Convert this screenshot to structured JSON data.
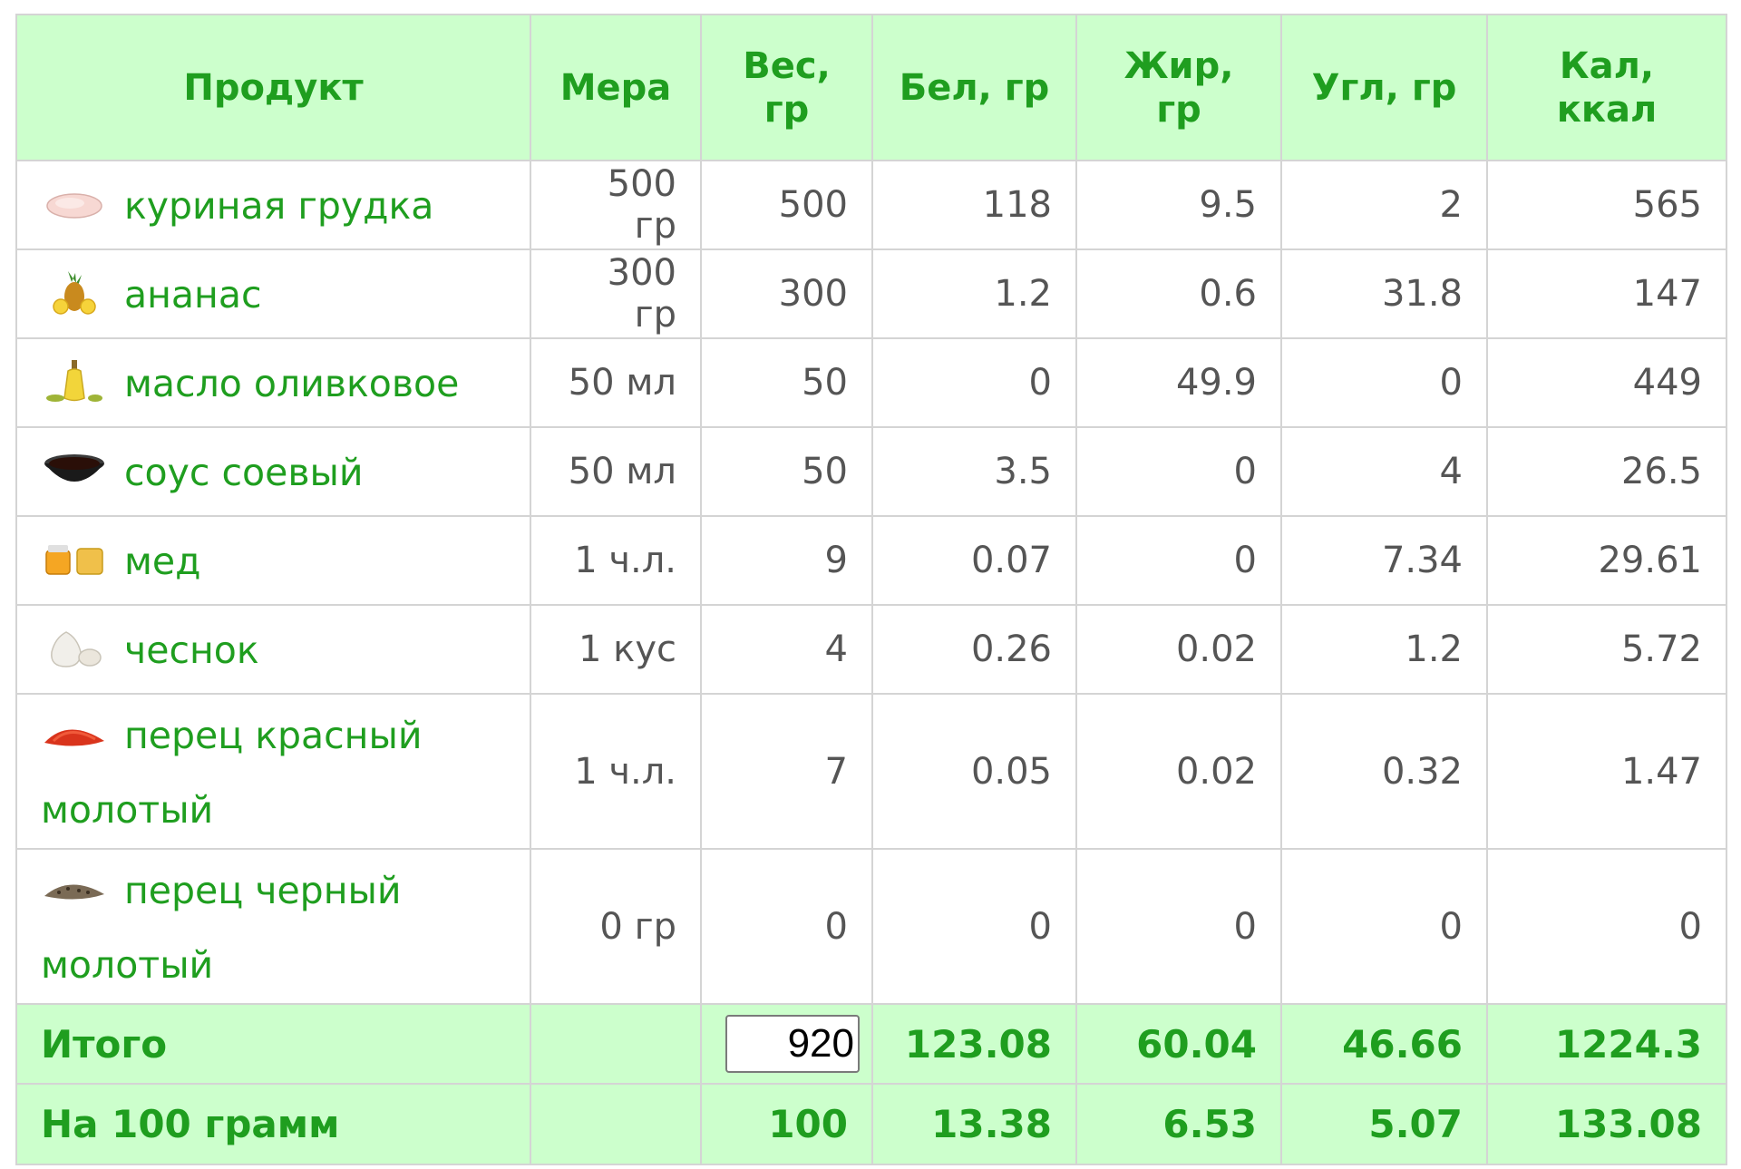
{
  "columns": [
    "Продукт",
    "Мера",
    "Вес, гр",
    "Бел, гр",
    "Жир, гр",
    "Угл, гр",
    "Кал, ккал"
  ],
  "colors": {
    "header_bg": "#ccffcc",
    "green_text": "#1f9e1f",
    "value_text": "#555555",
    "border": "#d4d4d4"
  },
  "rows": [
    {
      "icon": "chicken-breast-icon",
      "name": "куриная грудка",
      "measure": "500 гр",
      "weight": "500",
      "protein": "118",
      "fat": "9.5",
      "carbs": "2",
      "kcal": "565"
    },
    {
      "icon": "pineapple-icon",
      "name": "ананас",
      "measure": "300 гр",
      "weight": "300",
      "protein": "1.2",
      "fat": "0.6",
      "carbs": "31.8",
      "kcal": "147"
    },
    {
      "icon": "olive-oil-icon",
      "name": "масло оливковое",
      "measure": "50 мл",
      "weight": "50",
      "protein": "0",
      "fat": "49.9",
      "carbs": "0",
      "kcal": "449"
    },
    {
      "icon": "soy-sauce-icon",
      "name": "соус соевый",
      "measure": "50 мл",
      "weight": "50",
      "protein": "3.5",
      "fat": "0",
      "carbs": "4",
      "kcal": "26.5"
    },
    {
      "icon": "honey-icon",
      "name": "мед",
      "measure": "1 ч.л.",
      "weight": "9",
      "protein": "0.07",
      "fat": "0",
      "carbs": "7.34",
      "kcal": "29.61"
    },
    {
      "icon": "garlic-icon",
      "name": "чеснок",
      "measure": "1 кус",
      "weight": "4",
      "protein": "0.26",
      "fat": "0.02",
      "carbs": "1.2",
      "kcal": "5.72"
    },
    {
      "icon": "red-pepper-powder-icon",
      "name": "перец красный молотый",
      "measure": "1 ч.л.",
      "weight": "7",
      "protein": "0.05",
      "fat": "0.02",
      "carbs": "0.32",
      "kcal": "1.47"
    },
    {
      "icon": "black-pepper-powder-icon",
      "name": "перец черный молотый",
      "measure": "0 гр",
      "weight": "0",
      "protein": "0",
      "fat": "0",
      "carbs": "0",
      "kcal": "0"
    }
  ],
  "total": {
    "label": "Итого",
    "weight": "920",
    "protein": "123.08",
    "fat": "60.04",
    "carbs": "46.66",
    "kcal": "1224.3"
  },
  "per100": {
    "label": "На 100 грамм",
    "weight": "100",
    "protein": "13.38",
    "fat": "6.53",
    "carbs": "5.07",
    "kcal": "133.08"
  }
}
